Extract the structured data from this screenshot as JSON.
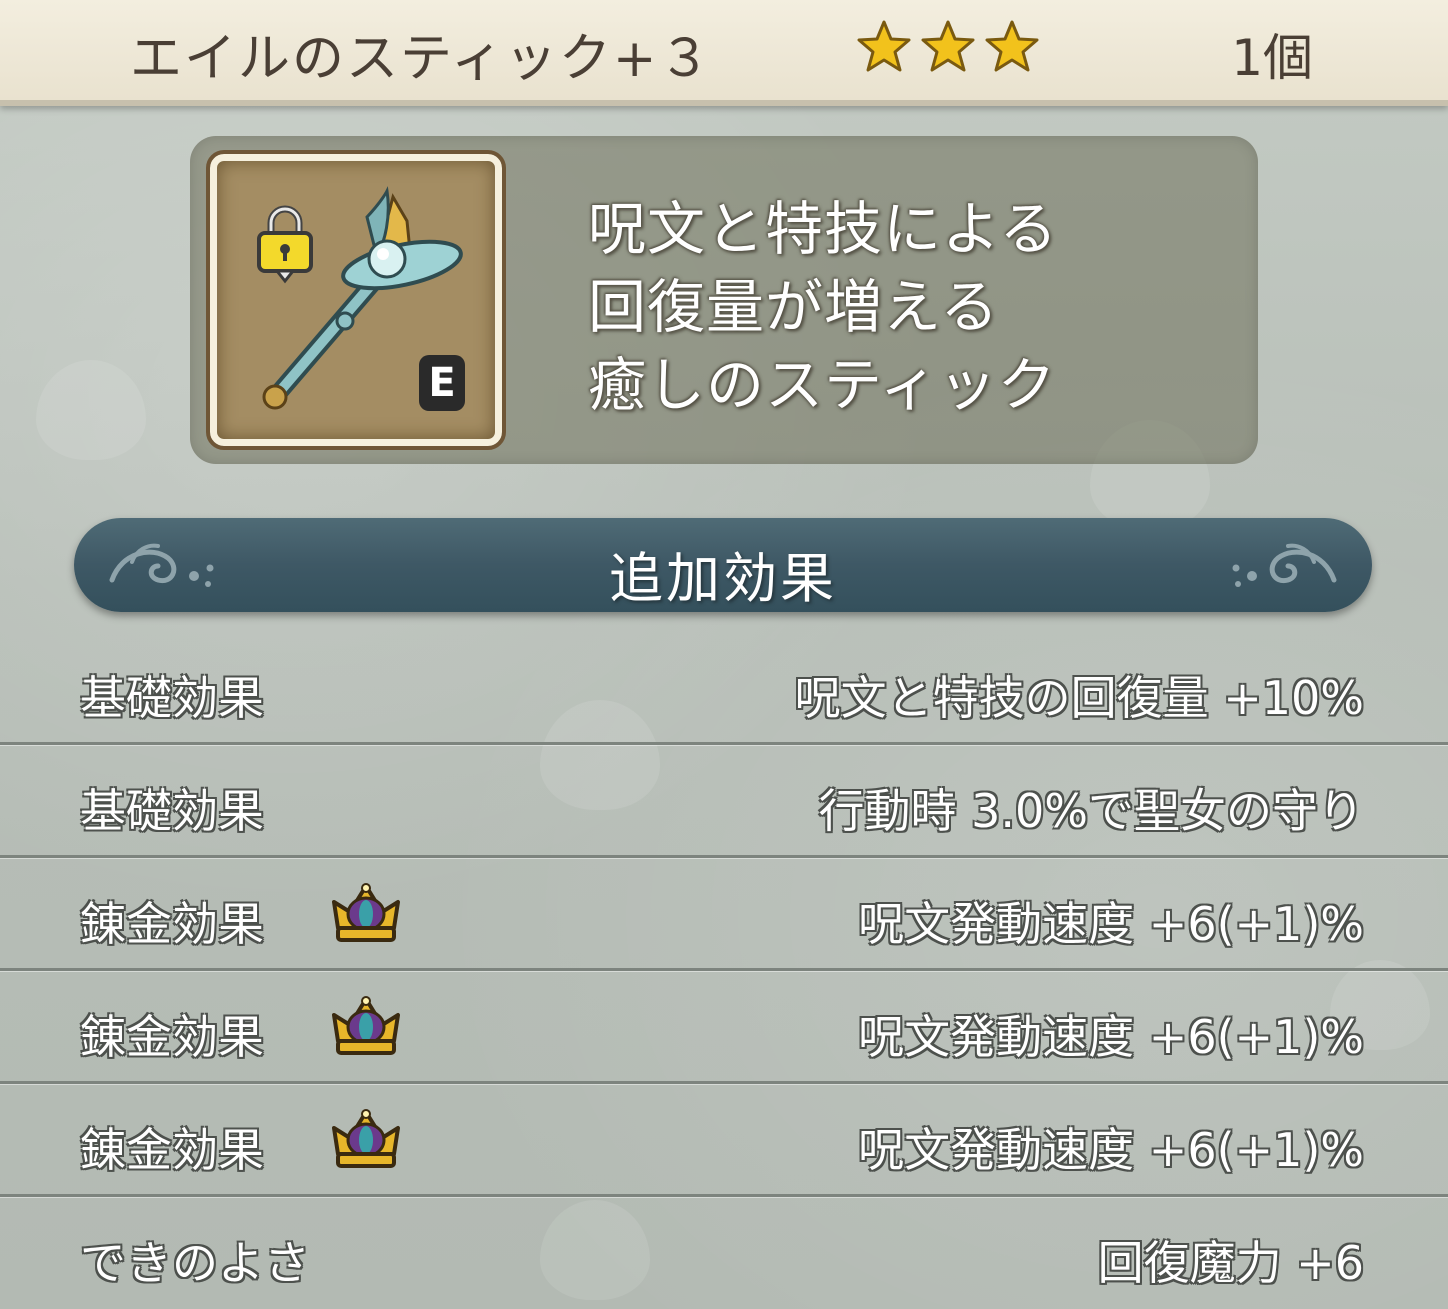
{
  "header": {
    "item_name": "エイルのスティック+３",
    "stars": 3,
    "star_color": "#f2c21c",
    "quantity": "1個"
  },
  "item": {
    "icon": "staff-icon",
    "lock_icon": "lock-icon",
    "grade": "E",
    "description_lines": [
      "呪文と特技による",
      "回復量が増える",
      "癒しのスティック"
    ]
  },
  "section": {
    "title": "追加効果"
  },
  "effects": [
    {
      "label": "基礎効果",
      "value": "呪文と特技の回復量 +10%",
      "icon": null
    },
    {
      "label": "基礎効果",
      "value": "行動時 3.0%で聖女の守り",
      "icon": null
    },
    {
      "label": "錬金効果",
      "value": "呪文発動速度 +6(+1)%",
      "icon": "alchemy-crown-icon"
    },
    {
      "label": "錬金効果",
      "value": "呪文発動速度 +6(+1)%",
      "icon": "alchemy-crown-icon"
    },
    {
      "label": "錬金効果",
      "value": "呪文発動速度 +6(+1)%",
      "icon": "alchemy-crown-icon"
    },
    {
      "label": "できのよさ",
      "value": "回復魔力 +6",
      "icon": null
    }
  ],
  "colors": {
    "header_bg": "#ece6d4",
    "banner_bg": "#3e5865",
    "crown_gold": "#e7b62a",
    "crown_purple": "#6b3a8c"
  }
}
